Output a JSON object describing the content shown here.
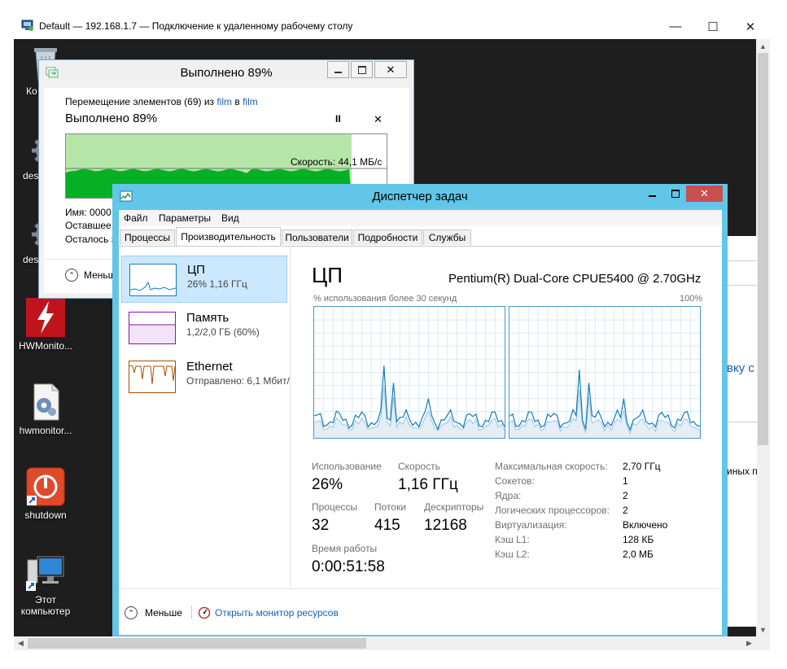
{
  "rdp": {
    "title": "Default — 192.168.1.7 — Подключение к удаленному рабочему столу",
    "controls": {
      "minimize": "—",
      "maximize": "☐",
      "close": "✕"
    }
  },
  "desktop": {
    "icons": [
      {
        "label": "Ко",
        "icon": "recycle-bin-icon"
      },
      {
        "label": "des",
        "icon": "gear-file-icon"
      },
      {
        "label": "des",
        "icon": "gear-file-icon"
      },
      {
        "label": "HWMonito...",
        "icon": "hwmonitor-icon"
      },
      {
        "label": "hwmonitor...",
        "icon": "setup-file-icon"
      },
      {
        "label": "shutdown",
        "icon": "power-icon"
      },
      {
        "label": "Этот компьютер",
        "icon": "computer-icon"
      }
    ]
  },
  "background_window": {
    "fragment_1": "вку с",
    "fragment_2": "иных п"
  },
  "copy_dialog": {
    "title": "Выполнено 89%",
    "line_prefix": "Перемещение элементов (69) из ",
    "source": "film",
    "line_mid": " в ",
    "destination": "film",
    "progress_text": "Выполнено 89%",
    "progress_fraction": 0.89,
    "pause_label": "II",
    "cancel_label": "✕",
    "speed_label": "Скорость: 44,1 МБ/с",
    "detail_name": "Имя: 0000",
    "detail_remaining_time": "Оставшее",
    "detail_remaining_items": "Осталось э",
    "less_label": "Меньш"
  },
  "task_manager": {
    "title": "Диспетчер задач",
    "menu": [
      "Файл",
      "Параметры",
      "Вид"
    ],
    "tabs": [
      "Процессы",
      "Производительность",
      "Пользователи",
      "Подробности",
      "Службы"
    ],
    "active_tab": "Производительность",
    "sidebar": [
      {
        "name": "ЦП",
        "sub": "26%  1,16 ГГц",
        "color": "#117dbb"
      },
      {
        "name": "Память",
        "sub": "1,2/2,0 ГБ (60%)",
        "color": "#8b12ae"
      },
      {
        "name": "Ethernet",
        "sub": "Отправлено: 6,1 Мбит/",
        "color": "#a74f01"
      }
    ],
    "detail": {
      "title": "ЦП",
      "model": "Pentium(R) Dual-Core CPUE5400 @ 2.70GHz",
      "graph_label": "% использования более 30 секунд",
      "graph_max": "100%",
      "stats": {
        "usage_label": "Использование",
        "usage_value": "26%",
        "speed_label": "Скорость",
        "speed_value": "1,16 ГГц",
        "processes_label": "Процессы",
        "processes_value": "32",
        "threads_label": "Потоки",
        "threads_value": "415",
        "handles_label": "Дескрипторы",
        "handles_value": "12168",
        "uptime_label": "Время работы",
        "uptime_value": "0:00:51:58"
      },
      "specs": [
        {
          "label": "Максимальная скорость:",
          "value": "2,70 ГГц"
        },
        {
          "label": "Сокетов:",
          "value": "1"
        },
        {
          "label": "Ядра:",
          "value": "2"
        },
        {
          "label": "Логических процессоров:",
          "value": "2"
        },
        {
          "label": "Виртуализация:",
          "value": "Включено"
        },
        {
          "label": "Кэш L1:",
          "value": "128 КБ"
        },
        {
          "label": "Кэш L2:",
          "value": "2,0 МБ"
        }
      ]
    },
    "footer": {
      "less_label": "Меньше",
      "monitor_link": "Открыть монитор ресурсов"
    }
  },
  "colors": {
    "tm_frame": "#62c6e8",
    "close_red": "#c75050",
    "cpu_line": "#117dbb",
    "copy_green": "#06b025",
    "link_blue": "#1a5fb4"
  }
}
